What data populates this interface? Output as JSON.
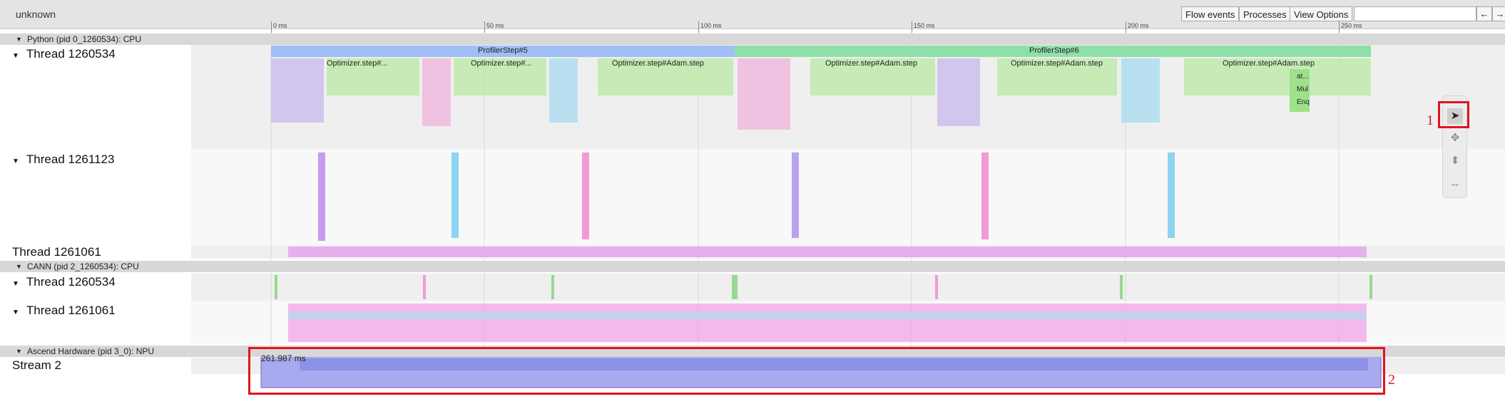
{
  "toolbar": {
    "title": "unknown",
    "flow_events": "Flow events",
    "processes": "Processes",
    "view_options": "View Options",
    "prev": "←",
    "next": "→"
  },
  "ruler": {
    "labels": [
      "0 ms",
      "50 ms",
      "100 ms",
      "150 ms",
      "200 ms",
      "250 ms"
    ]
  },
  "processes": [
    {
      "name": "Python (pid 0_1260534): CPU"
    },
    {
      "name": "CANN (pid 2_1260534): CPU"
    },
    {
      "name": "Ascend Hardware (pid 3_0): NPU"
    }
  ],
  "tracks": {
    "py_thread_1": "Thread 1260534",
    "py_thread_2": "Thread 1261123",
    "py_thread_3": "Thread 1261061",
    "cann_thread_1": "Thread 1260534",
    "cann_thread_2": "Thread 1261061",
    "npu_stream": "Stream 2"
  },
  "slices": {
    "profiler_step_5": "ProfilerStep#5",
    "profiler_step_6": "ProfilerStep#6",
    "opt_1": "Optimizer.step#...",
    "opt_2": "Optimizer.step#...",
    "opt_3": "Optimizer.step#Adam.step",
    "opt_4": "Optimizer.step#Adam.step",
    "opt_5": "Optimizer.step#Adam.step",
    "opt_6": "Optimizer.step#Adam.step",
    "sub_1": "at...",
    "sub_2": "Mul",
    "sub_3": "Enq"
  },
  "selection": {
    "duration": "261.987 ms"
  },
  "tools": {
    "selection": "selection-tool",
    "pan": "pan-tool",
    "zoom": "zoom-tool",
    "timing": "timing-tool"
  },
  "annotations": {
    "marker_1": "1",
    "marker_2": "2"
  },
  "colors": {
    "profiler_step_5": "#9fbff5",
    "profiler_step_6": "#8fe0a8",
    "selection_fill": "#a9a9f0",
    "highlight": "#e0141e"
  }
}
